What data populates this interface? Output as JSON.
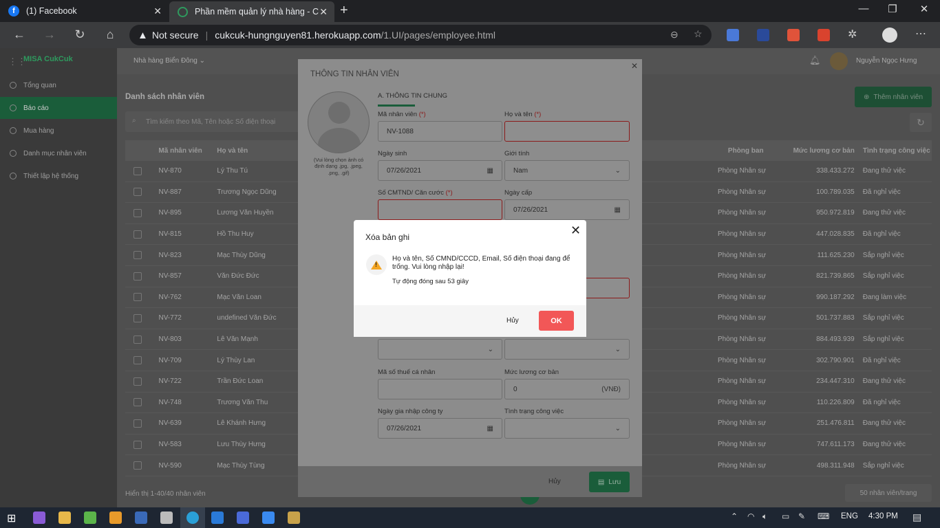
{
  "browser": {
    "tabs": [
      {
        "title": "(1) Facebook"
      },
      {
        "title": "Phần mềm quản lý nhà hàng - C"
      }
    ],
    "security": "Not secure",
    "url_host": "cukcuk-hungnguyen81.herokuapp.com",
    "url_path": "/1.UI/pages/employee.html"
  },
  "app": {
    "logo": "MISA CukCuk",
    "restaurant": "Nhà hàng Biển Đông",
    "user_name": "Nguyễn Ngọc Hưng",
    "sidebar": [
      {
        "label": "Tổng quan",
        "active": false
      },
      {
        "label": "Báo cáo",
        "active": true
      },
      {
        "label": "Mua hàng",
        "active": false
      },
      {
        "label": "Danh mục nhân viên",
        "active": false
      },
      {
        "label": "Thiết lập hệ thống",
        "active": false
      }
    ],
    "page_title": "Danh sách nhân viên",
    "add_button": "Thêm nhân viên",
    "search_placeholder": "Tìm kiếm theo Mã, Tên hoặc Số điện thoại",
    "columns": {
      "code": "Mã nhân viên",
      "name": "Họ và tên",
      "dept": "Phòng ban",
      "salary": "Mức lương cơ bản",
      "status": "Tình trạng công việc"
    },
    "rows": [
      {
        "code": "NV-870",
        "name": "Lý Thu Tú",
        "dept": "Phòng Nhân sự",
        "salary": "338.433.272",
        "status": "Đang thử việc"
      },
      {
        "code": "NV-887",
        "name": "Trương Ngọc Dũng",
        "dept": "Phòng Nhân sự",
        "salary": "100.789.035",
        "status": "Đã nghỉ việc"
      },
      {
        "code": "NV-895",
        "name": "Lương Văn Huyền",
        "dept": "Phòng Nhân sự",
        "salary": "950.972.819",
        "status": "Đang thử việc"
      },
      {
        "code": "NV-815",
        "name": "Hồ Thu Huy",
        "dept": "Phòng Nhân sự",
        "salary": "447.028.835",
        "status": "Đã nghỉ việc"
      },
      {
        "code": "NV-823",
        "name": "Mạc Thùy Dũng",
        "dept": "Phòng Nhân sự",
        "salary": "111.625.230",
        "status": "Sắp nghỉ việc"
      },
      {
        "code": "NV-857",
        "name": "Văn Đức Đức",
        "dept": "Phòng Nhân sự",
        "salary": "821.739.865",
        "status": "Sắp nghỉ việc"
      },
      {
        "code": "NV-762",
        "name": "Mạc Văn Loan",
        "dept": "Phòng Nhân sự",
        "salary": "990.187.292",
        "status": "Đang làm việc"
      },
      {
        "code": "NV-772",
        "name": "undefined Văn Đức",
        "dept": "Phòng Nhân sự",
        "salary": "501.737.883",
        "status": "Sắp nghỉ việc"
      },
      {
        "code": "NV-803",
        "name": "Lê Văn Mạnh",
        "dept": "Phòng Nhân sự",
        "salary": "884.493.939",
        "status": "Sắp nghỉ việc"
      },
      {
        "code": "NV-709",
        "name": "Lý Thùy Lan",
        "dept": "Phòng Nhân sự",
        "salary": "302.790.901",
        "status": "Đã nghỉ việc"
      },
      {
        "code": "NV-722",
        "name": "Trần Đức Loan",
        "dept": "Phòng Nhân sự",
        "salary": "234.447.310",
        "status": "Đang thử việc"
      },
      {
        "code": "NV-748",
        "name": "Trương Văn Thu",
        "dept": "Phòng Nhân sự",
        "salary": "110.226.809",
        "status": "Đã nghỉ việc"
      },
      {
        "code": "NV-639",
        "name": "Lê Khánh Hưng",
        "dept": "Phòng Nhân sự",
        "salary": "251.476.811",
        "status": "Đang thử việc"
      },
      {
        "code": "NV-583",
        "name": "Lưu Thùy Hưng",
        "dept": "Phòng Nhân sự",
        "salary": "747.611.173",
        "status": "Đang thử việc"
      },
      {
        "code": "NV-590",
        "name": "Mạc Thùy Tùng",
        "dept": "Phòng Nhân sự",
        "salary": "498.311.948",
        "status": "Sắp nghỉ việc"
      }
    ],
    "footer_count": "Hiển thị 1-40/40 nhân viên",
    "page_size": "50 nhân viên/trang"
  },
  "form": {
    "title": "THÔNG TIN NHÂN VIÊN",
    "photo_hint": "(Vui lòng chọn ảnh có định dạng .jpg, .jpeg, .png, .gif)",
    "section_a": "A. THÔNG TIN CHUNG",
    "req_mark": "(*)",
    "employee_code_label": "Mã nhân viên",
    "employee_code_value": "NV-1088",
    "full_name_label": "Họ và tên",
    "dob_label": "Ngày sinh",
    "dob_value": "07/26/2021",
    "gender_label": "Giới tính",
    "gender_value": "Nam",
    "id_label": "Số CMTND/ Căn cước",
    "issue_date_label": "Ngày cấp",
    "issue_date_value": "07/26/2021",
    "tax_label": "Mã số thuế cá nhân",
    "salary_label": "Mức lương cơ bản",
    "salary_value": "0",
    "salary_unit": "(VNĐ)",
    "join_date_label": "Ngày gia nhập công ty",
    "join_date_value": "07/26/2021",
    "work_status_label": "Tình trạng công việc",
    "cancel": "Hủy",
    "save": "Lưu"
  },
  "alert": {
    "title": "Xóa bản ghi",
    "message": "Họ và tên, Số CMND/CCCD, Email, Số điện thoại đang để trống. Vui lòng nhập lại!",
    "timer": "Tự động đóng sau 53 giây",
    "cancel": "Hủy",
    "ok": "OK"
  },
  "taskbar": {
    "lang": "ENG",
    "time": "4:30 PM"
  }
}
